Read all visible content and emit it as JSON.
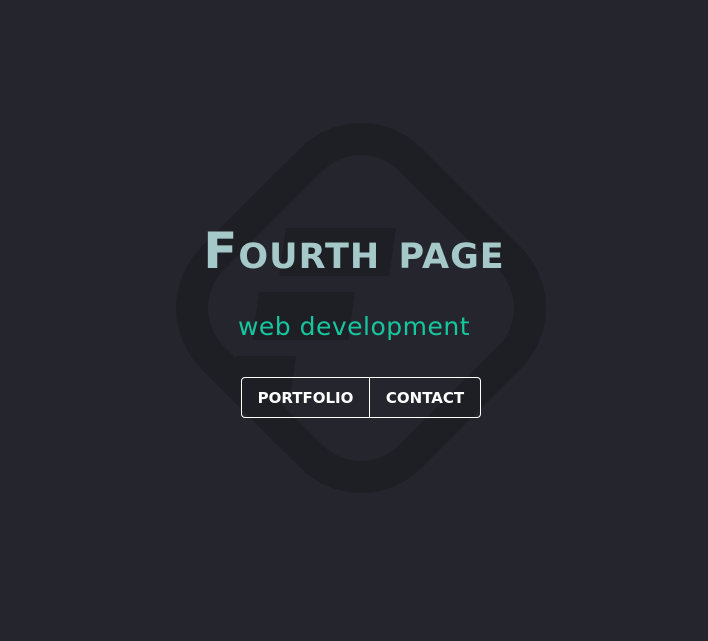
{
  "hero": {
    "title": "Fourth page",
    "subtitle": "web development"
  },
  "buttons": {
    "portfolio": "PORTFOLIO",
    "contact": "CONTACT"
  },
  "logo": {
    "mark_color": "#1e1f24",
    "bg_color": "#25262d"
  },
  "colors": {
    "title": "#a5c9c9",
    "subtitle": "#16c69f",
    "button_border": "#ffffff"
  }
}
